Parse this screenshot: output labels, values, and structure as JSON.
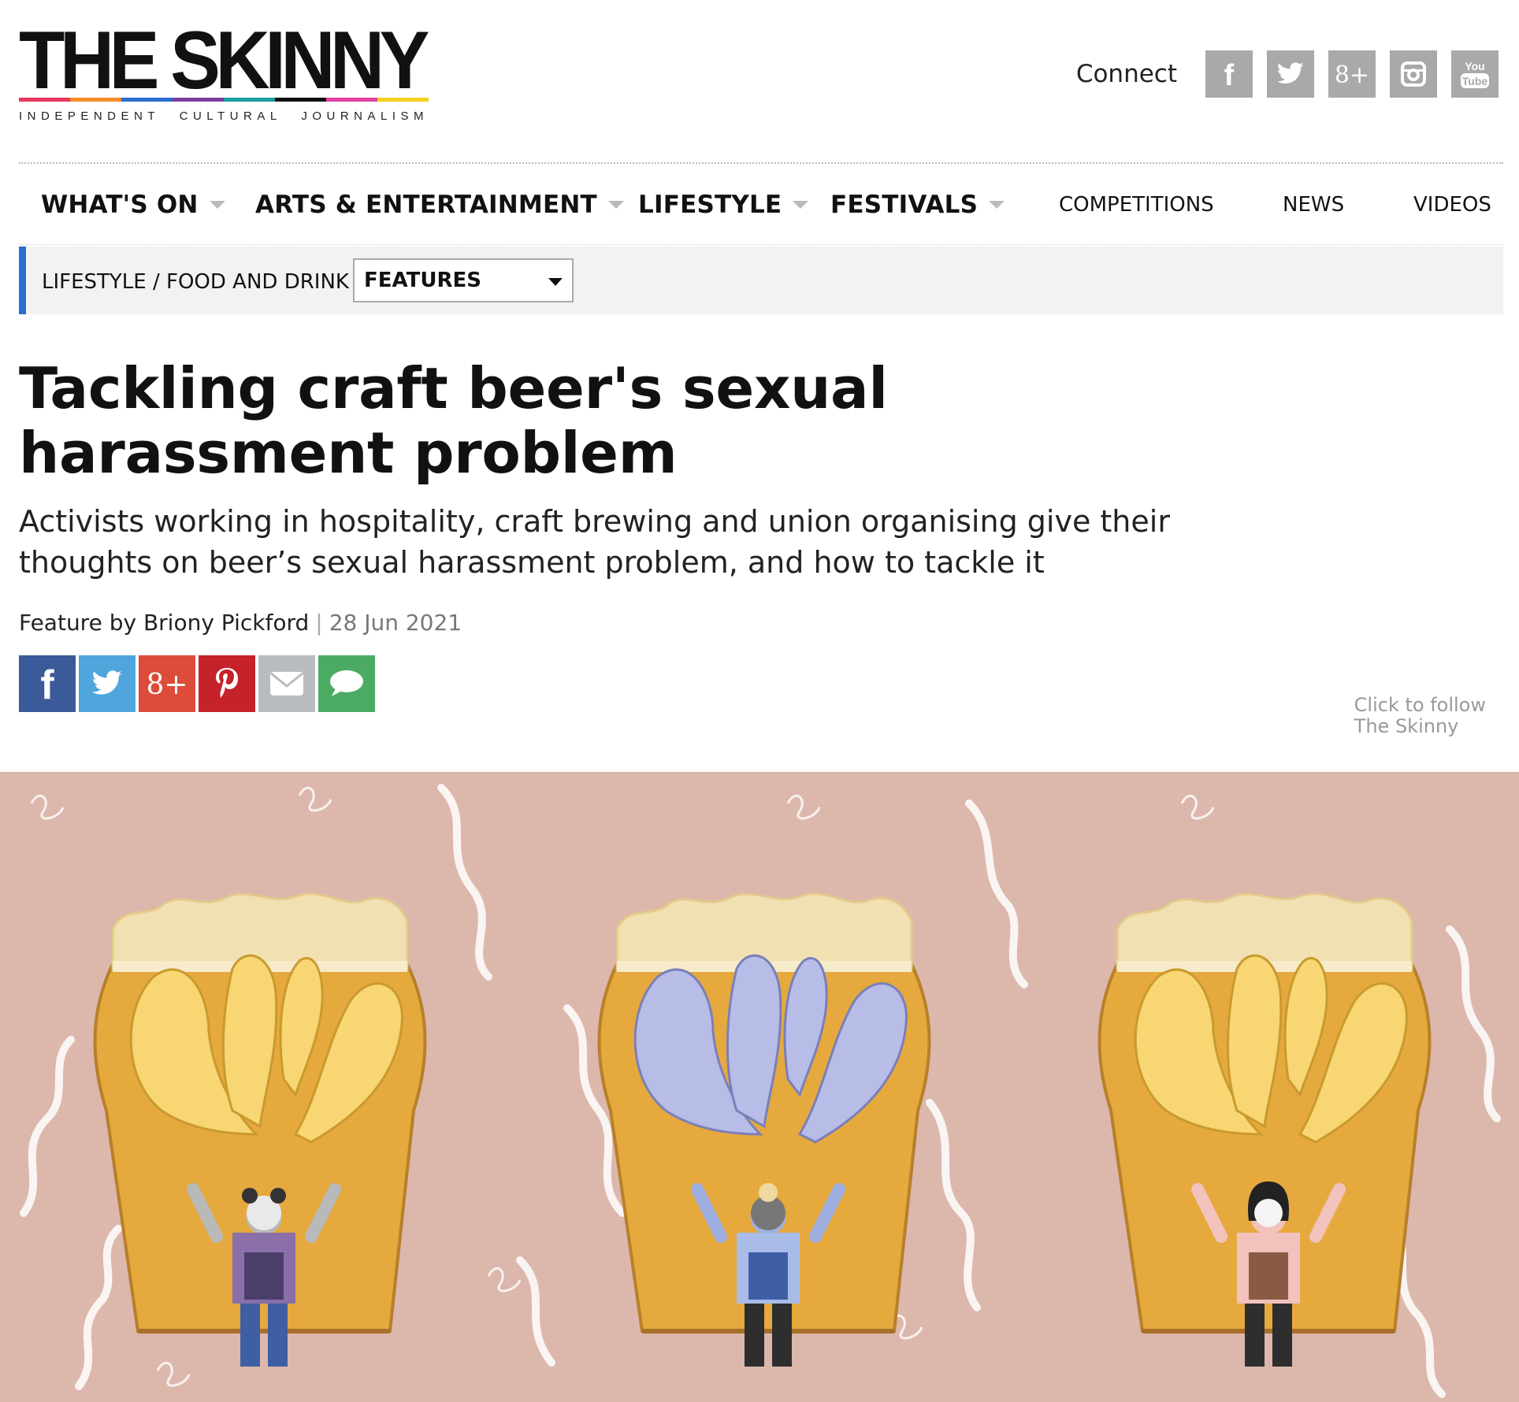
{
  "site": {
    "name": "THE SKINNY",
    "tagline": [
      "INDEPENDENT",
      "CULTURAL",
      "JOURNALISM"
    ],
    "stripe_colors": [
      "#e8365d",
      "#f28c28",
      "#2a6fce",
      "#7b3fa0",
      "#1aa0a0",
      "#111111",
      "#e23fa0",
      "#f5d020"
    ]
  },
  "connect": {
    "label": "Connect",
    "icons": [
      "facebook-icon",
      "twitter-icon",
      "google-plus-icon",
      "instagram-icon",
      "youtube-icon"
    ],
    "google_plus_text": "8+",
    "youtube_text_top": "You",
    "youtube_text_bottom": "Tube"
  },
  "nav": {
    "whats_on": "WHAT'S ON",
    "arts": "ARTS & ENTERTAINMENT",
    "lifestyle": "LIFESTYLE",
    "festivals": "FESTIVALS",
    "competitions": "COMPETITIONS",
    "news": "NEWS",
    "videos": "VIDEOS"
  },
  "breadcrumb": {
    "path": "LIFESTYLE / FOOD AND DRINK /",
    "selected": "FEATURES",
    "accent": "#2a6fce"
  },
  "article": {
    "title": "Tackling craft beer's sexual harassment problem",
    "standfirst": "Activists working in hospitality, craft brewing and union organising give their thoughts on beer’s sexual harassment problem, and how to tackle it",
    "byline_prefix": "Feature by Briony Pickford",
    "byline_sep": "|",
    "date": "28 Jun 2021"
  },
  "share": {
    "buttons": [
      {
        "icon": "facebook-icon",
        "color": "#3b5a9a"
      },
      {
        "icon": "twitter-icon",
        "color": "#4ea6dc"
      },
      {
        "icon": "google-plus-icon",
        "color": "#dd4b39"
      },
      {
        "icon": "pinterest-icon",
        "color": "#c6222a"
      },
      {
        "icon": "email-icon",
        "color": "#b8bcbf"
      },
      {
        "icon": "comment-icon",
        "color": "#4bab63"
      }
    ]
  },
  "follow": {
    "line1": "Click to follow",
    "line2": "The Skinny"
  },
  "hero": {
    "background": "#dcb7ac",
    "beer": "#e6a93d",
    "foam": "#f1e0b1"
  }
}
